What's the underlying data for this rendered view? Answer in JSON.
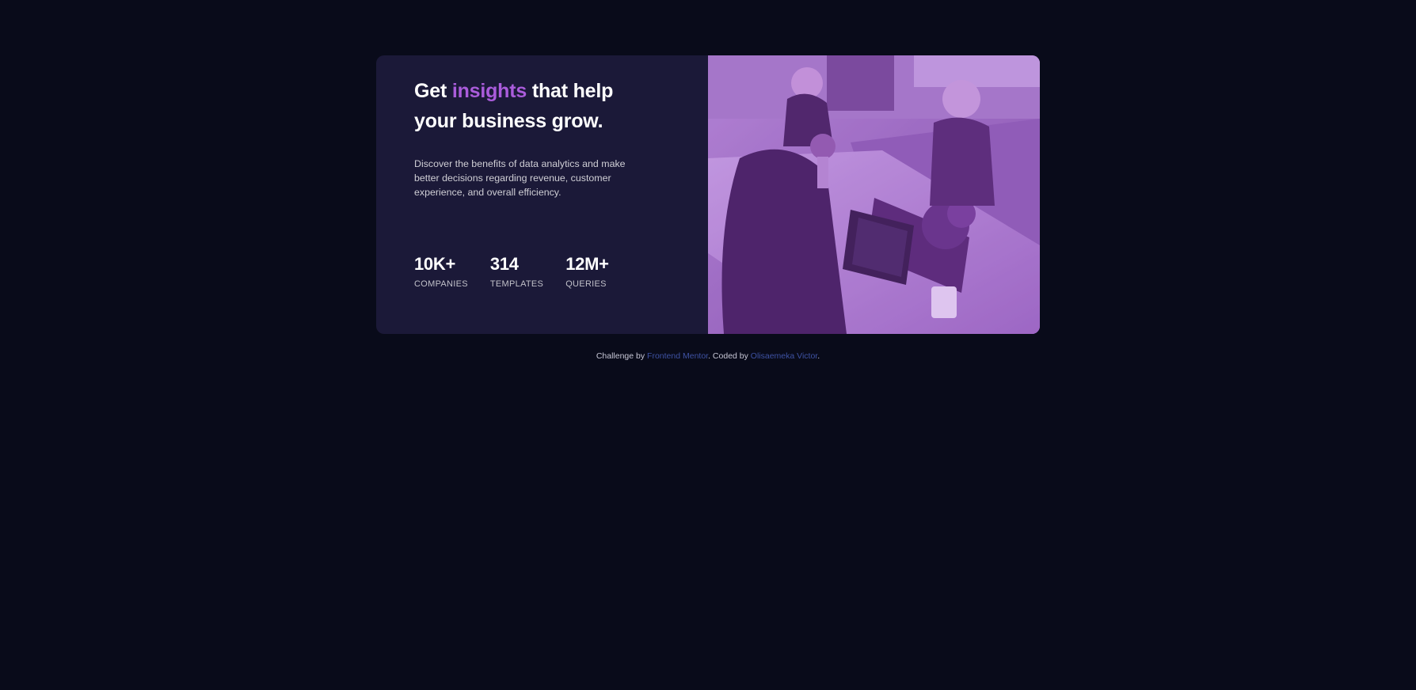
{
  "card": {
    "headline": {
      "prefix": "Get ",
      "accent": "insights",
      "suffix": " that help your business grow."
    },
    "description": "Discover the benefits of data analytics and make better decisions regarding revenue, customer experience, and overall efficiency.",
    "stats": [
      {
        "value": "10K+",
        "label": "COMPANIES"
      },
      {
        "value": "314",
        "label": "TEMPLATES"
      },
      {
        "value": "12M+",
        "label": "QUERIES"
      }
    ],
    "image": {
      "icon": "office-meeting-photo",
      "tint": "#aa5cdb"
    }
  },
  "footer": {
    "prefix": "Challenge by ",
    "link1": "Frontend Mentor",
    "middle": ". Coded by ",
    "link2": "Olisaemeka Victor",
    "suffix": "."
  },
  "colors": {
    "background": "#090b1a",
    "card": "#1b1938",
    "accent": "#aa5cdb",
    "link": "#3e52a3"
  }
}
